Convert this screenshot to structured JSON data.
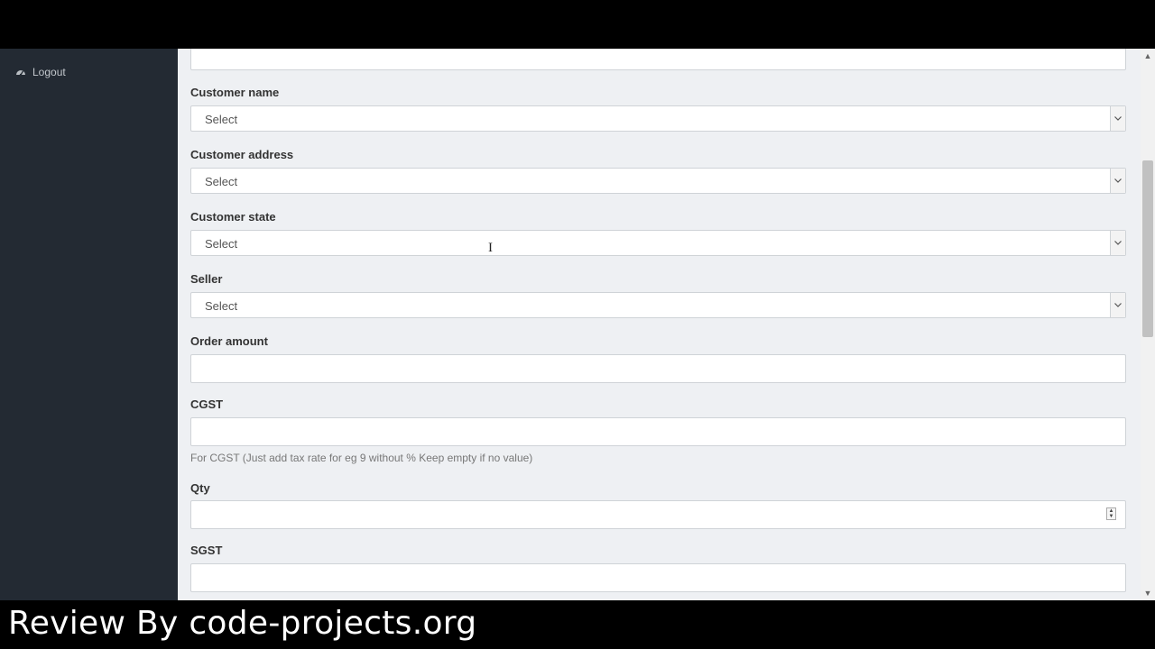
{
  "sidebar": {
    "items": [
      {
        "label": "Logout",
        "icon": "dashboard-icon"
      }
    ]
  },
  "form": {
    "fields": [
      {
        "label": "",
        "type": "text",
        "value": ""
      },
      {
        "label": "Customer name",
        "type": "select",
        "value": "Select"
      },
      {
        "label": "Customer address",
        "type": "select",
        "value": "Select"
      },
      {
        "label": "Customer state",
        "type": "select",
        "value": "Select"
      },
      {
        "label": "Seller",
        "type": "select",
        "value": "Select"
      },
      {
        "label": "Order amount",
        "type": "text",
        "value": ""
      },
      {
        "label": "CGST",
        "type": "text",
        "value": "",
        "help": "For CGST (Just add tax rate for eg 9 without % Keep empty if no value)"
      },
      {
        "label": "Qty",
        "type": "number",
        "value": ""
      },
      {
        "label": "SGST",
        "type": "text",
        "value": ""
      }
    ]
  },
  "watermark": {
    "text": "Review By code-projects.org"
  },
  "colors": {
    "sidebar": "#232a33",
    "content": "#eef0f3",
    "border": "#cfd3d7"
  }
}
